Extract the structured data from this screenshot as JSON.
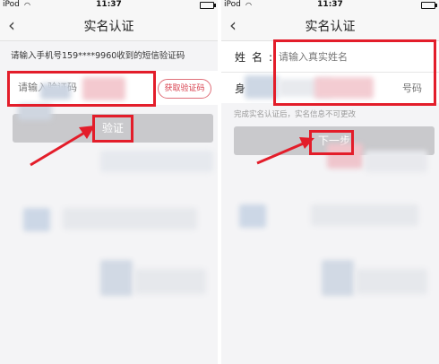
{
  "status": {
    "carrier": "iPod",
    "time": "11:37"
  },
  "left": {
    "title": "实名认证",
    "info": "请输入手机号159****9960收到的短信验证码",
    "code_placeholder": "请输入验证码",
    "get_code_label": "获取验证码",
    "verify_label": "验证"
  },
  "right": {
    "title": "实名认证",
    "name_label": "姓名:",
    "name_placeholder": "请输入真实姓名",
    "id_label": "身",
    "id_placeholder": "号码",
    "notice": "完成实名认证后，实名信息不可更改",
    "next_label": "下一步"
  },
  "colors": {
    "highlight": "#e31d2a",
    "accent": "#d8424f",
    "disabled_button": "#c9c9cc"
  }
}
